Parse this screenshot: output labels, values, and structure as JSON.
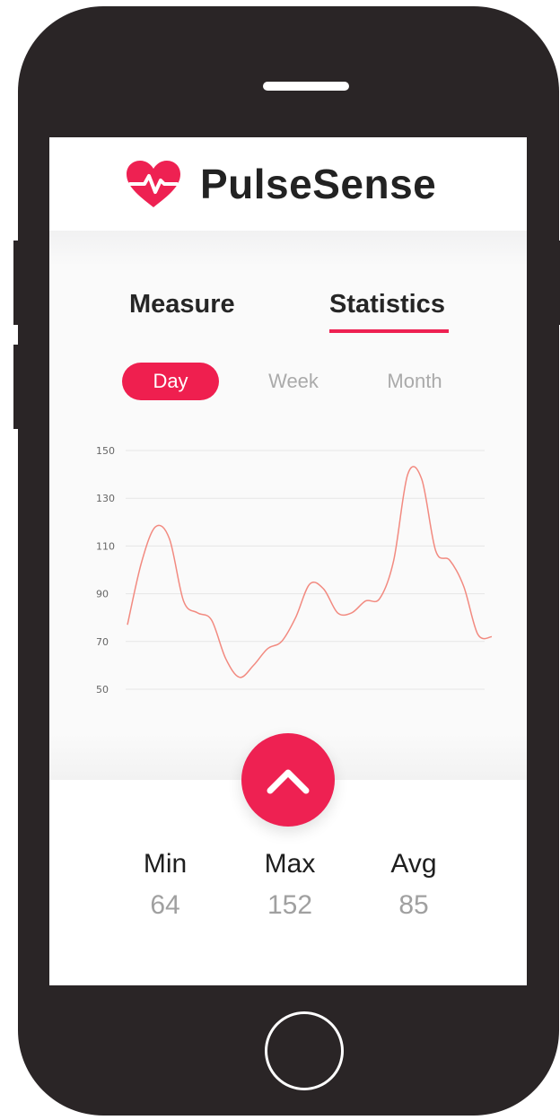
{
  "app": {
    "title": "PulseSense",
    "accent_color": "#ee2152",
    "logo_icon": "heart-pulse-icon"
  },
  "tabs": {
    "measure_label": "Measure",
    "statistics_label": "Statistics",
    "active": "Statistics"
  },
  "periods": {
    "day_label": "Day",
    "week_label": "Week",
    "month_label": "Month",
    "active": "Day"
  },
  "chart_data": {
    "type": "line",
    "yticks": [
      150,
      130,
      110,
      90,
      70,
      50
    ],
    "ylim": [
      50,
      150
    ],
    "grid": true,
    "line_color": "#f28a80",
    "series": [
      {
        "values": [
          77,
          103,
          118,
          113,
          87,
          82,
          79,
          63,
          55,
          60,
          67,
          70,
          80,
          94,
          92,
          82,
          82,
          87,
          88,
          104,
          140,
          138,
          108,
          104,
          93,
          73,
          72
        ]
      }
    ]
  },
  "fab": {
    "icon": "chevron-up-icon"
  },
  "summary": {
    "min_label": "Min",
    "min_value": "64",
    "max_label": "Max",
    "max_value": "152",
    "avg_label": "Avg",
    "avg_value": "85"
  }
}
